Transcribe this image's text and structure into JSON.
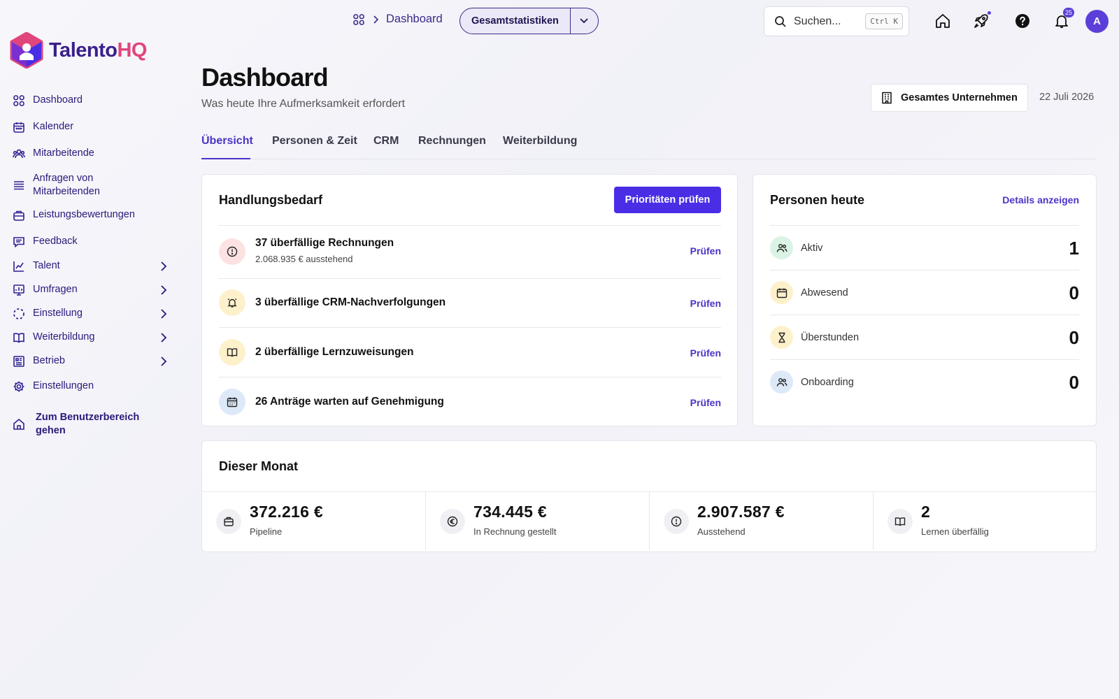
{
  "brand": {
    "name_part1": "Talento",
    "name_part2": "HQ"
  },
  "sidebar": {
    "items": [
      {
        "label": "Dashboard",
        "icon": "grid-icon"
      },
      {
        "label": "Kalender",
        "icon": "calendar-icon"
      },
      {
        "label": "Mitarbeitende",
        "icon": "people-icon"
      },
      {
        "label": "Anfragen von Mitarbeitenden",
        "icon": "list-icon"
      },
      {
        "label": "Leistungsbewertungen",
        "icon": "briefcase-icon"
      },
      {
        "label": "Feedback",
        "icon": "chat-icon"
      },
      {
        "label": "Talent",
        "icon": "chart-icon",
        "expandable": true
      },
      {
        "label": "Umfragen",
        "icon": "survey-icon",
        "expandable": true
      },
      {
        "label": "Einstellung",
        "icon": "dashed-circle-icon",
        "expandable": true
      },
      {
        "label": "Weiterbildung",
        "icon": "book-icon",
        "expandable": true
      },
      {
        "label": "Betrieb",
        "icon": "building-icon",
        "expandable": true
      },
      {
        "label": "Einstellungen",
        "icon": "gear-icon"
      },
      {
        "label": "Zum Benutzerbereich gehen",
        "icon": "home-icon"
      }
    ]
  },
  "topbar": {
    "breadcrumb_current": "Dashboard",
    "scope_label": "Gesamtstatistiken",
    "search_placeholder": "Suchen...",
    "search_shortcut": "Ctrl K",
    "notification_count": "25",
    "avatar_initial": "A"
  },
  "header": {
    "title": "Dashboard",
    "subtitle": "Was heute Ihre Aufmerksamkeit erfordert",
    "company_filter": "Gesamtes Unternehmen",
    "date": "22 Juli 2026"
  },
  "tabs": [
    {
      "label": "Übersicht",
      "active": true
    },
    {
      "label": "Personen & Zeit"
    },
    {
      "label": "CRM"
    },
    {
      "label": "Rechnungen"
    },
    {
      "label": "Weiterbildung"
    }
  ],
  "action_card": {
    "title": "Handlungsbedarf",
    "button": "Prioritäten prüfen",
    "rows": [
      {
        "title": "37 überfällige Rechnungen",
        "sub": "2.068.935 € ausstehend",
        "link": "Prüfen",
        "icon": "alert-circle-icon",
        "tone": "red"
      },
      {
        "title": "3 überfällige CRM-Nachverfolgungen",
        "link": "Prüfen",
        "icon": "bell-icon",
        "tone": "yellow"
      },
      {
        "title": "2 überfällige Lernzuweisungen",
        "link": "Prüfen",
        "icon": "book-icon",
        "tone": "yellow"
      },
      {
        "title": "26 Anträge warten auf Genehmigung",
        "link": "Prüfen",
        "icon": "calendar-icon",
        "tone": "blue"
      }
    ]
  },
  "people_card": {
    "title": "Personen heute",
    "link": "Details anzeigen",
    "rows": [
      {
        "label": "Aktiv",
        "value": "1",
        "icon": "people-icon",
        "tone": "green"
      },
      {
        "label": "Abwesend",
        "value": "0",
        "icon": "calendar-icon",
        "tone": "yellow"
      },
      {
        "label": "Überstunden",
        "value": "0",
        "icon": "hourglass-icon",
        "tone": "yellow"
      },
      {
        "label": "Onboarding",
        "value": "0",
        "icon": "people-icon",
        "tone": "blue"
      }
    ]
  },
  "month_card": {
    "title": "Dieser Monat",
    "stats": [
      {
        "value": "372.216 €",
        "label": "Pipeline",
        "icon": "briefcase-icon"
      },
      {
        "value": "734.445 €",
        "label": "In Rechnung gestellt",
        "icon": "euro-icon"
      },
      {
        "value": "2.907.587 €",
        "label": "Ausstehend",
        "icon": "alert-circle-icon"
      },
      {
        "value": "2",
        "label": "Lernen überfällig",
        "icon": "book-icon"
      }
    ]
  }
}
